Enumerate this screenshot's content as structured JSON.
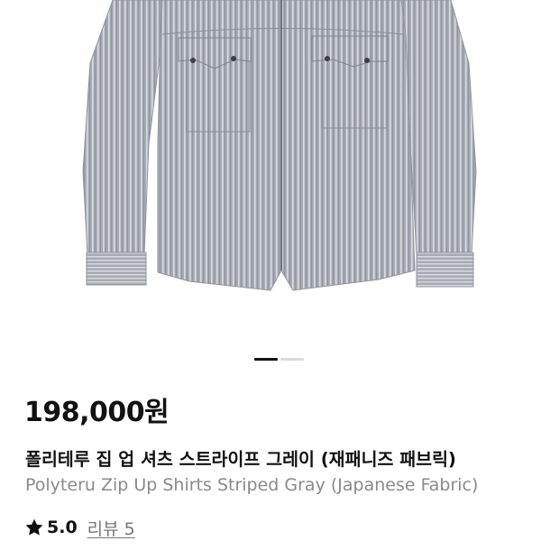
{
  "product": {
    "image_alt": "Polyteru Zip Up Shirts Striped Gray",
    "price": "198,000원",
    "title_ko": "폴리테루 집 업 셔츠 스트라이프 그레이 (재패니즈 패브릭)",
    "title_en": "Polyteru Zip Up Shirts Striped Gray (Japanese Fabric)"
  },
  "gallery": {
    "total": 2,
    "active_index": 0
  },
  "rating": {
    "icon": "star-icon",
    "score": "5.0",
    "review_label": "리뷰 5"
  },
  "colors": {
    "text_primary": "#111111",
    "text_secondary": "#8a8a8a",
    "shirt_base": "#a9adb4",
    "pager_active": "#111111",
    "pager_inactive": "#dadada"
  }
}
